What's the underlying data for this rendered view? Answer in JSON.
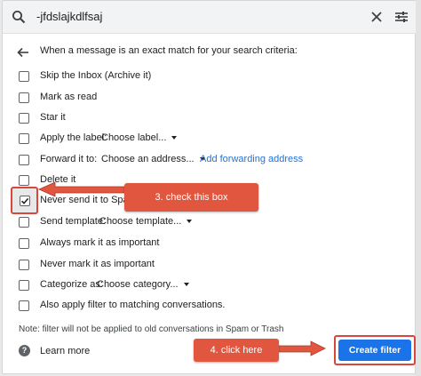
{
  "search": {
    "query": "-jfdslajkdlfsaj"
  },
  "header": {
    "text": "When a message is an exact match for your search criteria:"
  },
  "options": {
    "skip_inbox": "Skip the Inbox (Archive it)",
    "mark_read": "Mark as read",
    "star": "Star it",
    "apply_label": "Apply the label:",
    "label_select": "Choose label...",
    "forward": "Forward it to:",
    "forward_select": "Choose an address...",
    "add_forwarding": "Add forwarding address",
    "delete": "Delete it",
    "never_spam": "Never send it to Spam",
    "send_template": "Send template:",
    "template_select": "Choose template...",
    "always_important": "Always mark it as important",
    "never_important": "Never mark it as important",
    "categorize": "Categorize as:",
    "category_select": "Choose category...",
    "also_apply": "Also apply filter to matching conversations."
  },
  "note": "Note: filter will not be applied to old conversations in Spam or Trash",
  "learn_more": "Learn more",
  "create_filter": "Create filter",
  "callouts": {
    "step3": "3. check this box",
    "step4": "4. click here"
  },
  "colors": {
    "accent": "#1a73e8",
    "annotation": "#e0563f"
  },
  "checkbox_states": {
    "never_spam": true
  }
}
